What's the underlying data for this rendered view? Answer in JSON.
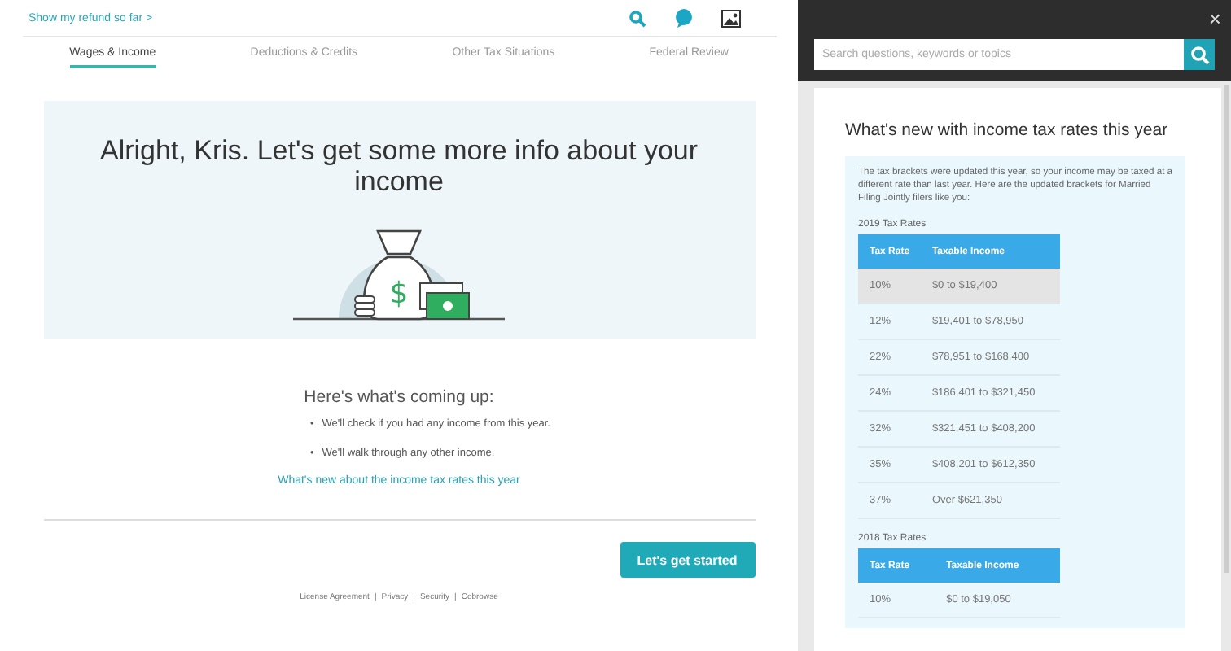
{
  "top_bar": {
    "refund_link": "Show my refund so far",
    "chevron": ">"
  },
  "tabs": [
    {
      "label": "Wages & Income",
      "selected": true
    },
    {
      "label": "Deductions & Credits",
      "selected": false
    },
    {
      "label": "Other Tax Situations",
      "selected": false
    },
    {
      "label": "Federal Review",
      "selected": false
    }
  ],
  "hero": {
    "title": "Alright, Kris. Let's get some more info about your income",
    "art_symbol": "$"
  },
  "coming_up": {
    "heading": "Here's what's coming up:",
    "bullet_marker": "•",
    "bullets": [
      "We'll check if you had any income from this year.",
      "We'll walk through any other income."
    ],
    "link": "What's new about the income tax rates this year"
  },
  "primary_button": "Let's get started",
  "footer_links": [
    "License Agreement",
    "Privacy",
    "Security",
    "Cobrowse"
  ],
  "footer_separator": "|",
  "help_panel": {
    "close": "×",
    "search": {
      "placeholder": "Search questions, keywords or topics"
    },
    "title": "What's new with income tax rates this year",
    "intro": "The tax brackets were updated this year, so your income may be taxed at a different rate than last year. Here are the updated brackets for Married Filing Jointly filers like you:",
    "tables": [
      {
        "caption": "2019 Tax Rates",
        "columns": [
          "Tax Rate",
          "Taxable Income"
        ],
        "rows": [
          {
            "cells": [
              "10%",
              "$0 to $19,400"
            ],
            "highlighted": true
          },
          {
            "cells": [
              "12%",
              "$19,401 to $78,950"
            ],
            "highlighted": false
          },
          {
            "cells": [
              "22%",
              "$78,951 to $168,400"
            ],
            "highlighted": false
          },
          {
            "cells": [
              "24%",
              "$186,401 to $321,450"
            ],
            "highlighted": false
          },
          {
            "cells": [
              "32%",
              "$321,451 to $408,200"
            ],
            "highlighted": false
          },
          {
            "cells": [
              "35%",
              "$408,201 to $612,350"
            ],
            "highlighted": false
          },
          {
            "cells": [
              "37%",
              "Over $621,350"
            ],
            "highlighted": false
          }
        ]
      },
      {
        "caption": "2018 Tax Rates",
        "columns": [
          "Tax Rate",
          "Taxable Income"
        ],
        "rows": [
          {
            "cells": [
              "10%",
              "$0 to $19,050"
            ],
            "highlighted": false
          }
        ]
      }
    ]
  }
}
